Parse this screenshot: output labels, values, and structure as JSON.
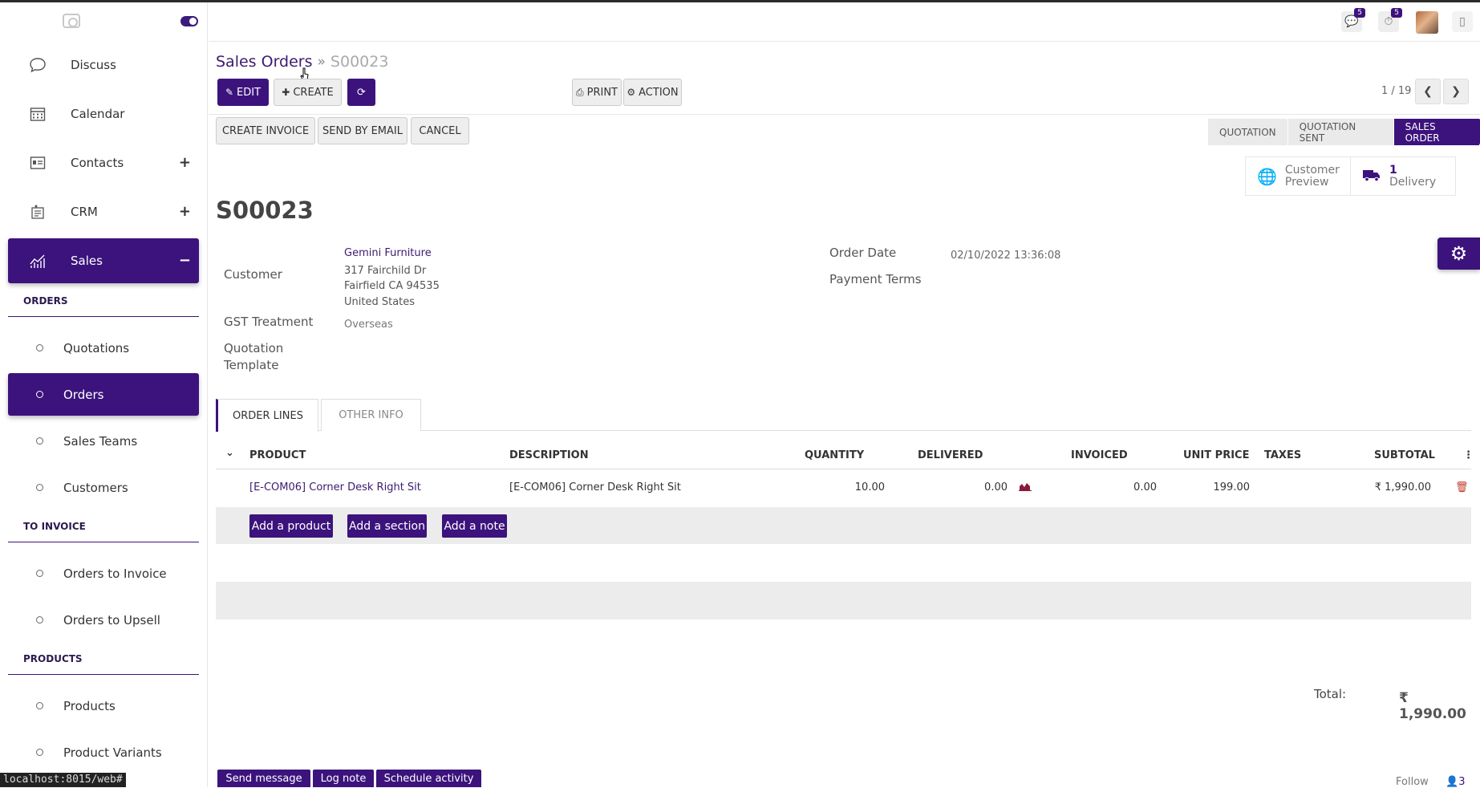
{
  "topbar": {
    "chat_badge": "5",
    "activity_badge": "5"
  },
  "sidebar": {
    "apps": [
      {
        "label": "Discuss",
        "icon": "chat-icon"
      },
      {
        "label": "Calendar",
        "icon": "calendar-icon"
      },
      {
        "label": "Contacts",
        "icon": "contacts-icon",
        "expand": "+"
      },
      {
        "label": "CRM",
        "icon": "crm-icon",
        "expand": "+"
      },
      {
        "label": "Sales",
        "icon": "sales-chart-icon",
        "expand": "−"
      }
    ],
    "sections": [
      {
        "title": "ORDERS",
        "items": [
          "Quotations",
          "Orders",
          "Sales Teams",
          "Customers"
        ]
      },
      {
        "title": "TO INVOICE",
        "items": [
          "Orders to Invoice",
          "Orders to Upsell"
        ]
      },
      {
        "title": "PRODUCTS",
        "items": [
          "Products",
          "Product Variants"
        ]
      }
    ]
  },
  "status_url": "localhost:8015/web#",
  "breadcrumb": {
    "parent": "Sales Orders",
    "separator": "»",
    "current": "S00023"
  },
  "toolbar": {
    "edit": "EDIT",
    "create": "CREATE",
    "print": "PRINT",
    "action": "ACTION"
  },
  "pager": {
    "value": "1 / 19"
  },
  "status_buttons": {
    "create_invoice": "CREATE INVOICE",
    "send_by_email": "SEND BY EMAIL",
    "cancel": "CANCEL"
  },
  "stages": [
    "QUOTATION",
    "QUOTATION SENT",
    "SALES ORDER"
  ],
  "smart_buttons": {
    "preview_line1": "Customer",
    "preview_line2": "Preview",
    "delivery_count": "1",
    "delivery_label": "Delivery"
  },
  "form": {
    "name": "S00023",
    "customer_label": "Customer",
    "customer_name": "Gemini Furniture",
    "address_line1": "317 Fairchild Dr",
    "address_line2": "Fairfield CA 94535",
    "address_line3": "United States",
    "gst_label": "GST Treatment",
    "gst_value": "Overseas",
    "template_label_1": "Quotation",
    "template_label_2": "Template",
    "order_date_label": "Order Date",
    "order_date_value": "02/10/2022 13:36:08",
    "payment_terms_label": "Payment Terms"
  },
  "tabs": [
    "ORDER LINES",
    "OTHER INFO"
  ],
  "table": {
    "headers": {
      "product": "PRODUCT",
      "description": "DESCRIPTION",
      "quantity": "QUANTITY",
      "delivered": "DELIVERED",
      "invoiced": "INVOICED",
      "unit_price": "UNIT PRICE",
      "taxes": "TAXES",
      "subtotal": "SUBTOTAL"
    },
    "rows": [
      {
        "product": "[E-COM06] Corner Desk Right Sit",
        "description": "[E-COM06] Corner Desk Right Sit",
        "quantity": "10.00",
        "delivered": "0.00",
        "invoiced": "0.00",
        "unit_price": "199.00",
        "taxes": "",
        "subtotal": "₹ 1,990.00"
      }
    ],
    "add_product": "Add a product",
    "add_section": "Add a section",
    "add_note": "Add a note"
  },
  "totals": {
    "label": "Total:",
    "value": "₹ 1,990.00"
  },
  "chatter": {
    "send_message": "Send message",
    "log_note": "Log note",
    "schedule_activity": "Schedule activity",
    "follow": "Follow",
    "followers": "3"
  },
  "colors": {
    "brand": "#3c137c"
  }
}
